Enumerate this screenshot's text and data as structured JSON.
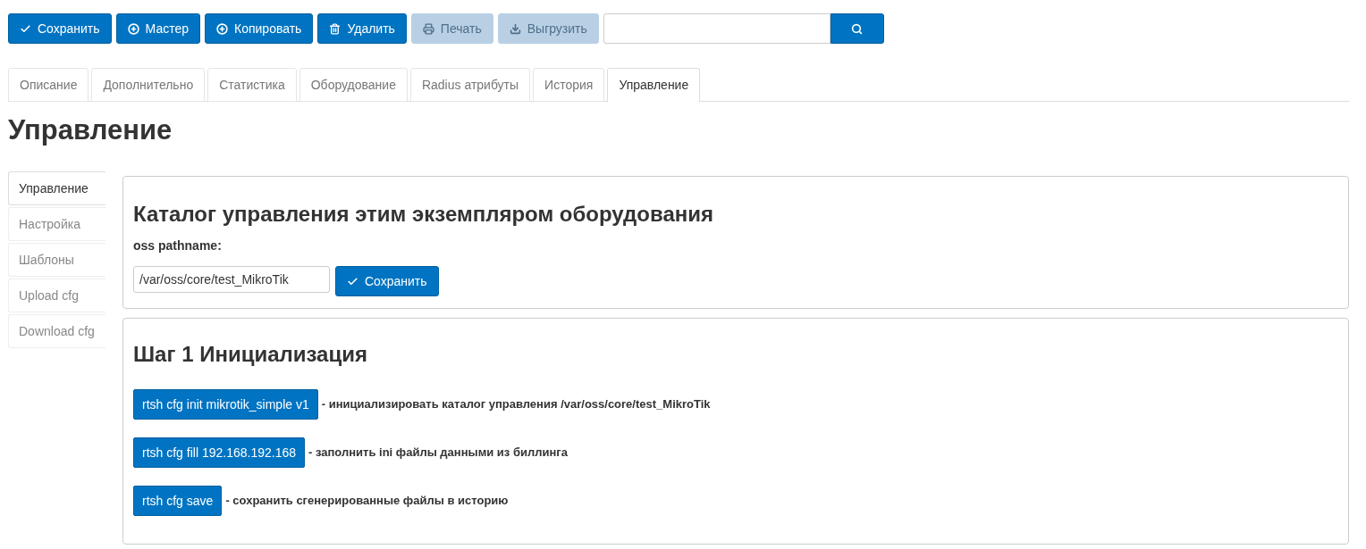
{
  "toolbar": [
    {
      "label": "Сохранить",
      "kind": "check",
      "disabled": false
    },
    {
      "label": "Мастер",
      "kind": "plus",
      "disabled": false
    },
    {
      "label": "Копировать",
      "kind": "plus",
      "disabled": false
    },
    {
      "label": "Удалить",
      "kind": "trash",
      "disabled": false
    },
    {
      "label": "Печать",
      "kind": "print",
      "disabled": true
    },
    {
      "label": "Выгрузить",
      "kind": "download",
      "disabled": true
    }
  ],
  "tabs": [
    {
      "label": "Описание",
      "selected": false
    },
    {
      "label": "Дополнительно",
      "selected": false
    },
    {
      "label": "Статистика",
      "selected": false
    },
    {
      "label": "Оборудование",
      "selected": false
    },
    {
      "label": "Radius атрибуты",
      "selected": false
    },
    {
      "label": "История",
      "selected": false
    },
    {
      "label": "Управление",
      "selected": true
    }
  ],
  "page_title": "Управление",
  "side_tabs": [
    {
      "label": "Управление",
      "selected": true
    },
    {
      "label": "Настройка",
      "selected": false
    },
    {
      "label": "Шаблоны",
      "selected": false
    },
    {
      "label": "Upload cfg",
      "selected": false
    },
    {
      "label": "Download cfg",
      "selected": false
    }
  ],
  "catalog_panel": {
    "title": "Каталог управления этим экземпляром оборудования",
    "field_label": "oss pathname:",
    "field_value": "/var/oss/core/test_MikroTik",
    "save_button": "Сохранить"
  },
  "step_panel": {
    "title": "Шаг 1 Инициализация",
    "commands": [
      {
        "button": "rtsh cfg init mikrotik_simple v1",
        "description": "- инициализировать каталог управления /var/oss/core/test_MikroTik"
      },
      {
        "button": "rtsh cfg fill 192.168.192.168",
        "description": "- заполнить ini файлы данными из биллинга"
      },
      {
        "button": "rtsh cfg save",
        "description": "- сохранить сгенерированные файлы в историю"
      }
    ]
  }
}
